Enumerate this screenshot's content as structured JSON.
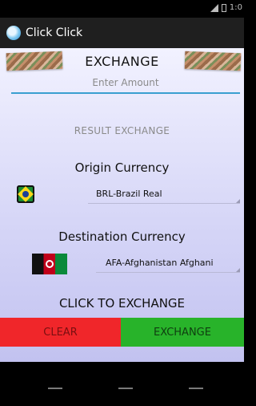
{
  "status_bar": {
    "time": "1:0"
  },
  "app": {
    "title": "Click Click"
  },
  "header": {
    "title": "EXCHANGE"
  },
  "amount_input": {
    "placeholder": "Enter Amount",
    "value": ""
  },
  "result": {
    "text": "RESULT EXCHANGE"
  },
  "origin": {
    "title": "Origin Currency",
    "selected": "BRL-Brazil Real",
    "flag_icon": "brazil-flag-icon"
  },
  "destination": {
    "title": "Destination Currency",
    "selected": "AFA-Afghanistan Afghani",
    "flag_icon": "afghanistan-flag-icon"
  },
  "actions": {
    "prompt": "CLICK TO EXCHANGE",
    "clear_label": "CLEAR",
    "exchange_label": "EXCHANGE"
  },
  "colors": {
    "clear": "#f0262a",
    "exchange": "#28b32a",
    "input_underline": "#3a9fd1"
  }
}
